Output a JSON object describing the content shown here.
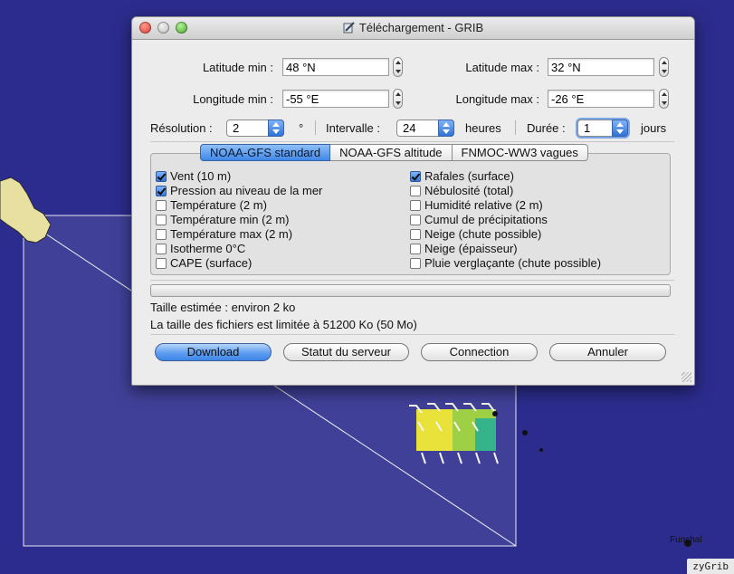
{
  "window": {
    "title": "Téléchargement - GRIB"
  },
  "region": {
    "lat_min_label": "Latitude min :",
    "lat_min_value": "48 °N",
    "lat_max_label": "Latitude max :",
    "lat_max_value": "32 °N",
    "lon_min_label": "Longitude min :",
    "lon_min_value": "-55 °E",
    "lon_max_label": "Longitude max :",
    "lon_max_value": "-26 °E"
  },
  "params": {
    "resolution_label": "Résolution :",
    "resolution_value": "2",
    "resolution_unit": "°",
    "interval_label": "Intervalle :",
    "interval_value": "24",
    "interval_unit": "heures",
    "duration_label": "Durée :",
    "duration_value": "1",
    "duration_unit": "jours"
  },
  "tabs": [
    {
      "label": "NOAA-GFS standard",
      "active": true
    },
    {
      "label": "NOAA-GFS altitude",
      "active": false
    },
    {
      "label": "FNMOC-WW3 vagues",
      "active": false
    }
  ],
  "checkboxes_left": [
    {
      "label": "Vent (10 m)",
      "checked": true
    },
    {
      "label": "Pression au niveau de la mer",
      "checked": true
    },
    {
      "label": "Température (2 m)",
      "checked": false
    },
    {
      "label": "Température min (2 m)",
      "checked": false
    },
    {
      "label": "Température max (2 m)",
      "checked": false
    },
    {
      "label": "Isotherme 0°C",
      "checked": false
    },
    {
      "label": "CAPE (surface)",
      "checked": false
    }
  ],
  "checkboxes_right": [
    {
      "label": "Rafales (surface)",
      "checked": true
    },
    {
      "label": "Nébulosité (total)",
      "checked": false
    },
    {
      "label": "Humidité relative (2 m)",
      "checked": false
    },
    {
      "label": "Cumul de précipitations",
      "checked": false
    },
    {
      "label": "Neige (chute possible)",
      "checked": false
    },
    {
      "label": "Neige (épaisseur)",
      "checked": false
    },
    {
      "label": "Pluie verglaçante (chute possible)",
      "checked": false
    }
  ],
  "status": {
    "estimated_size": "Taille estimée : environ 2 ko",
    "size_limit": "La taille des fichiers est limitée à 51200 Ko (50 Mo)"
  },
  "buttons": {
    "download": "Download",
    "server_status": "Statut du serveur",
    "connection": "Connection",
    "cancel": "Annuler"
  },
  "map": {
    "city_label": "Funchal",
    "app_label": "zyGrib",
    "ocean_color": "#2c2c8e",
    "land_color": "#e8e0a0"
  }
}
